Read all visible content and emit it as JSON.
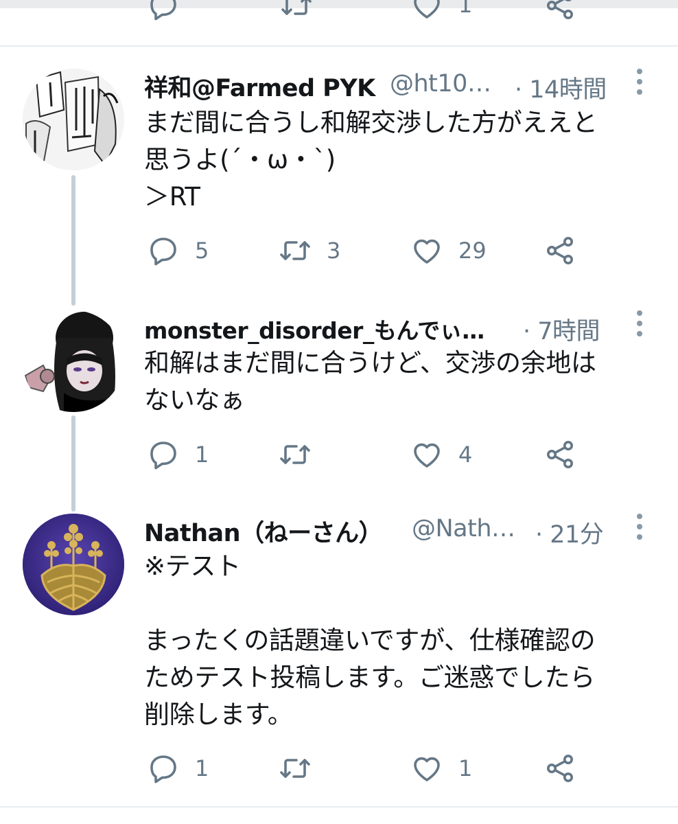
{
  "tweets": [
    {
      "name": "祥和@Farmed PYK",
      "handle": "@ht10…",
      "time": "· 14時間",
      "lines": [
        "まだ間に合うし和解交渉した方がええと",
        "思うよ(´・ω・`)",
        "＞RT"
      ],
      "replies": "5",
      "retweets": "3",
      "likes": "29"
    },
    {
      "name": "monster_disorder_もんでぃ…",
      "handle": "",
      "time": "· 7時間",
      "lines": [
        "和解はまだ間に合うけど、交渉の余地は",
        "ないなぁ"
      ],
      "replies": "1",
      "retweets": "",
      "likes": "4"
    },
    {
      "name": "Nathan（ねーさん）",
      "handle": "@Nath…",
      "time": "· 21分",
      "lines": [
        "※テスト",
        "",
        "まったくの話題違いですが、仕様確認の",
        "ためテスト投稿します。ご迷惑でしたら",
        "削除します。"
      ],
      "replies": "1",
      "retweets": "",
      "likes": "1"
    }
  ],
  "previous_tweet_actions": {
    "likes": "1"
  },
  "icons": {
    "reply": "reply-icon",
    "retweet": "retweet-icon",
    "like": "like-icon",
    "share": "share-icon",
    "more": "more-options-icon"
  },
  "colors": {
    "text": "#14171a",
    "secondary": "#657786",
    "icon": "#657786",
    "thread_line": "#c4cfd6",
    "divider": "#e6ecf0"
  }
}
